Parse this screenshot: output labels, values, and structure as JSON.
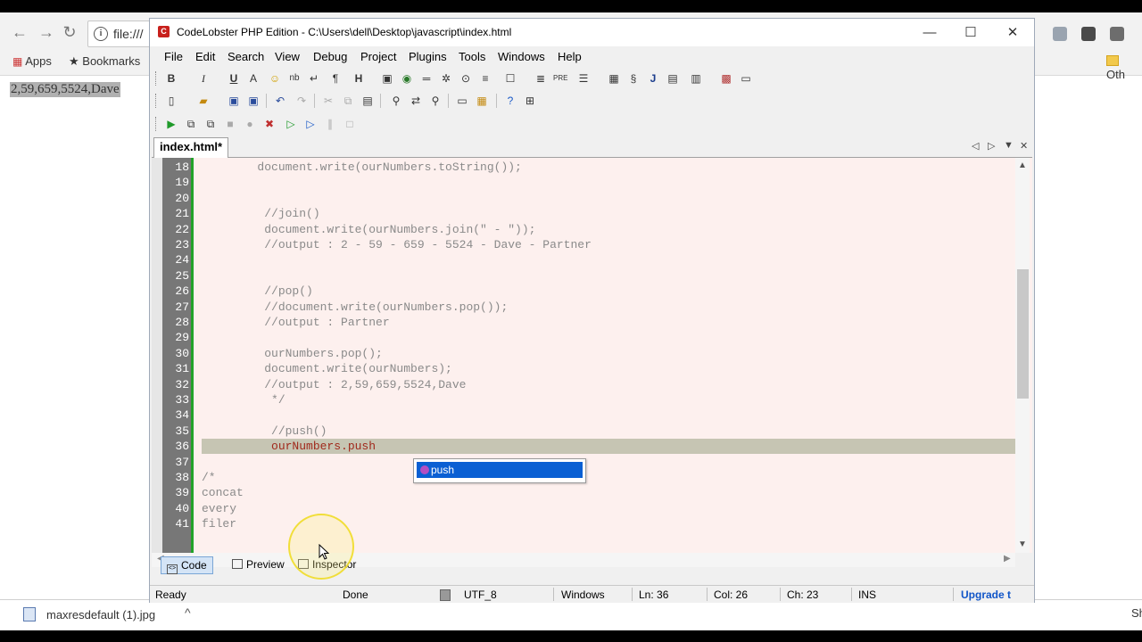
{
  "browser": {
    "omnibox_text": "file:///",
    "bookmarks": {
      "apps": "Apps",
      "bookmarks": "Bookmarks",
      "other": "Oth"
    },
    "page_output": "2,59,659,5524,Dave"
  },
  "downloads": {
    "filename": "maxresdefault (1).jpg",
    "show_all": "Sh"
  },
  "ide": {
    "title": "CodeLobster PHP Edition - C:\\Users\\dell\\Desktop\\javascript\\index.html",
    "menu": [
      "File",
      "Edit",
      "Search",
      "View",
      "Debug",
      "Project",
      "Plugins",
      "Tools",
      "Windows",
      "Help"
    ],
    "tab": "index.html*",
    "lines": [
      {
        "n": "18",
        "code": "        document.write(ourNumbers.toString());"
      },
      {
        "n": "19",
        "code": ""
      },
      {
        "n": "20",
        "code": ""
      },
      {
        "n": "21",
        "code": "         //join()"
      },
      {
        "n": "22",
        "code": "         document.write(ourNumbers.join(\" - \"));"
      },
      {
        "n": "23",
        "code": "         //output : 2 - 59 - 659 - 5524 - Dave - Partner"
      },
      {
        "n": "24",
        "code": ""
      },
      {
        "n": "25",
        "code": ""
      },
      {
        "n": "26",
        "code": "         //pop()"
      },
      {
        "n": "27",
        "code": "         //document.write(ourNumbers.pop());"
      },
      {
        "n": "28",
        "code": "         //output : Partner"
      },
      {
        "n": "29",
        "code": ""
      },
      {
        "n": "30",
        "code": "         ourNumbers.pop();"
      },
      {
        "n": "31",
        "code": "         document.write(ourNumbers);"
      },
      {
        "n": "32",
        "code": "         //output : 2,59,659,5524,Dave"
      },
      {
        "n": "33",
        "code": "          */"
      },
      {
        "n": "34",
        "code": ""
      },
      {
        "n": "35",
        "code": "          //push()"
      },
      {
        "n": "36",
        "code": "          ourNumbers.push"
      },
      {
        "n": "37",
        "code": ""
      },
      {
        "n": "38",
        "code": "/*"
      },
      {
        "n": "39",
        "code": "concat"
      },
      {
        "n": "40",
        "code": "every"
      },
      {
        "n": "41",
        "code": "filer"
      }
    ],
    "autocomplete": {
      "item": "push"
    },
    "view_tabs": [
      "Code",
      "Preview",
      "Inspector"
    ],
    "status": {
      "ready": "Ready",
      "done": "Done",
      "encoding": "UTF_8",
      "line_endings": "Windows",
      "ln": "Ln: 36",
      "col": "Col: 26",
      "ch": "Ch: 23",
      "mode": "INS",
      "upgrade": "Upgrade t"
    }
  }
}
